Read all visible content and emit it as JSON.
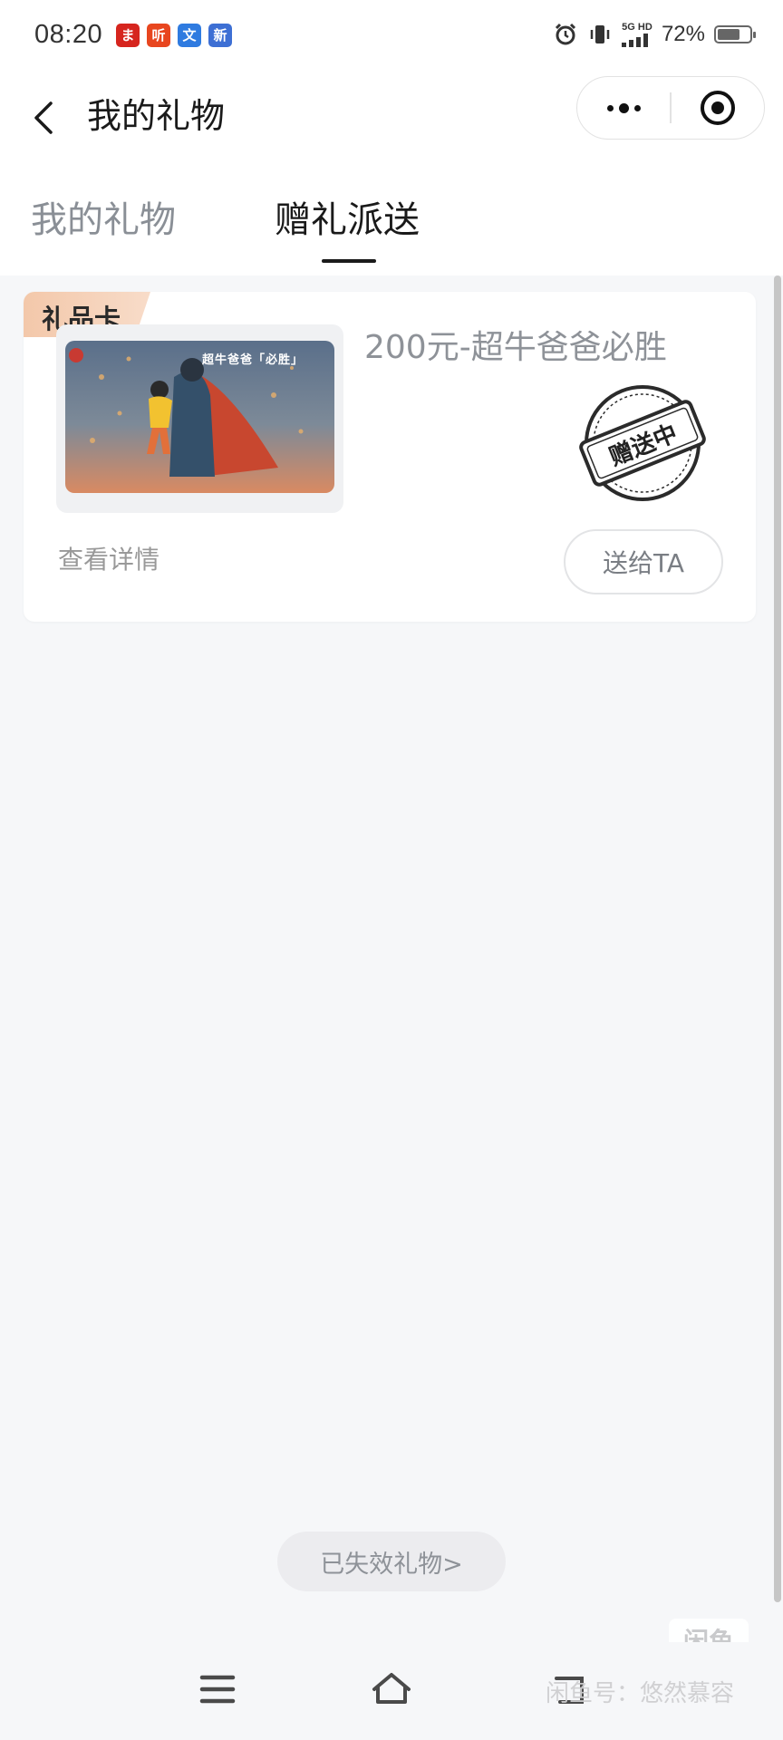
{
  "status_bar": {
    "time": "08:20",
    "app_icons": [
      {
        "glyph": "ま",
        "color": "#d6251e",
        "name": "app-icon-1"
      },
      {
        "glyph": "听",
        "color": "#e8461f",
        "name": "app-icon-2"
      },
      {
        "glyph": "文",
        "color": "#2f7be0",
        "name": "app-icon-3"
      },
      {
        "glyph": "新",
        "color": "#3d6fd4",
        "name": "app-icon-4"
      }
    ],
    "network_label": "5G HD",
    "battery_percent": "72%",
    "battery_level": 0.72
  },
  "header": {
    "title": "我的礼物"
  },
  "tabs": [
    {
      "label": "我的礼物",
      "active": false
    },
    {
      "label": "赠礼派送",
      "active": true
    }
  ],
  "gift_card": {
    "badge": "礼品卡",
    "image_caption": "超牛爸爸「必胜」",
    "name": "200元-超牛爸爸必胜",
    "stamp_text": "赠送中",
    "view_details": "查看详情",
    "send_button": "送给TA"
  },
  "footer": {
    "expired_link": "已失效礼物>"
  },
  "watermark": {
    "logo": "闲鱼",
    "text": "闲鱼号：悠然慕容"
  },
  "colors": {
    "background": "#f6f7f9",
    "badge": "#f3c8aa",
    "muted_text": "#8e9298"
  }
}
